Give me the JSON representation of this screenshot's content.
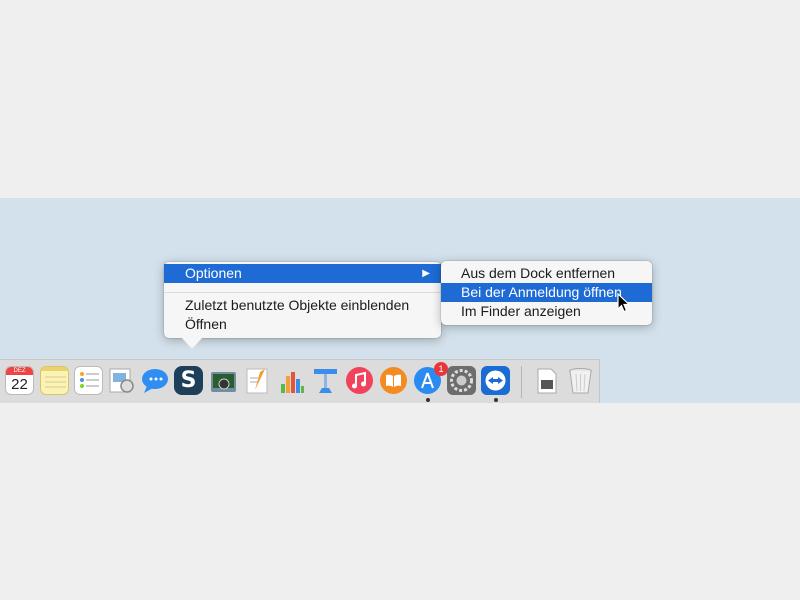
{
  "context_menu": {
    "items": [
      {
        "label": "Optionen"
      },
      {
        "label": "Zuletzt benutzte Objekte einblenden"
      },
      {
        "label": "Öffnen"
      }
    ],
    "submenu_arrow": "▶"
  },
  "submenu": {
    "items": [
      {
        "label": "Aus dem Dock entfernen"
      },
      {
        "label": "Bei der Anmeldung öffnen"
      },
      {
        "label": "Im Finder anzeigen"
      }
    ]
  },
  "dock": {
    "calendar": {
      "month": "DEZ",
      "day": "22"
    },
    "app_store_badge": "1",
    "icons": [
      "calendar-icon",
      "notes-icon",
      "reminders-icon",
      "preview-icon",
      "messages-icon",
      "skype-icon",
      "image-capture-icon",
      "pages-icon",
      "numbers-icon",
      "keynote-icon",
      "itunes-icon",
      "ibooks-icon",
      "app-store-icon",
      "system-preferences-icon",
      "teamviewer-icon",
      "downloads-icon",
      "trash-icon"
    ]
  },
  "colors": {
    "highlight": "#1e6bd6",
    "desktop": "#d3e1ec",
    "dock": "#dcdcdc"
  }
}
